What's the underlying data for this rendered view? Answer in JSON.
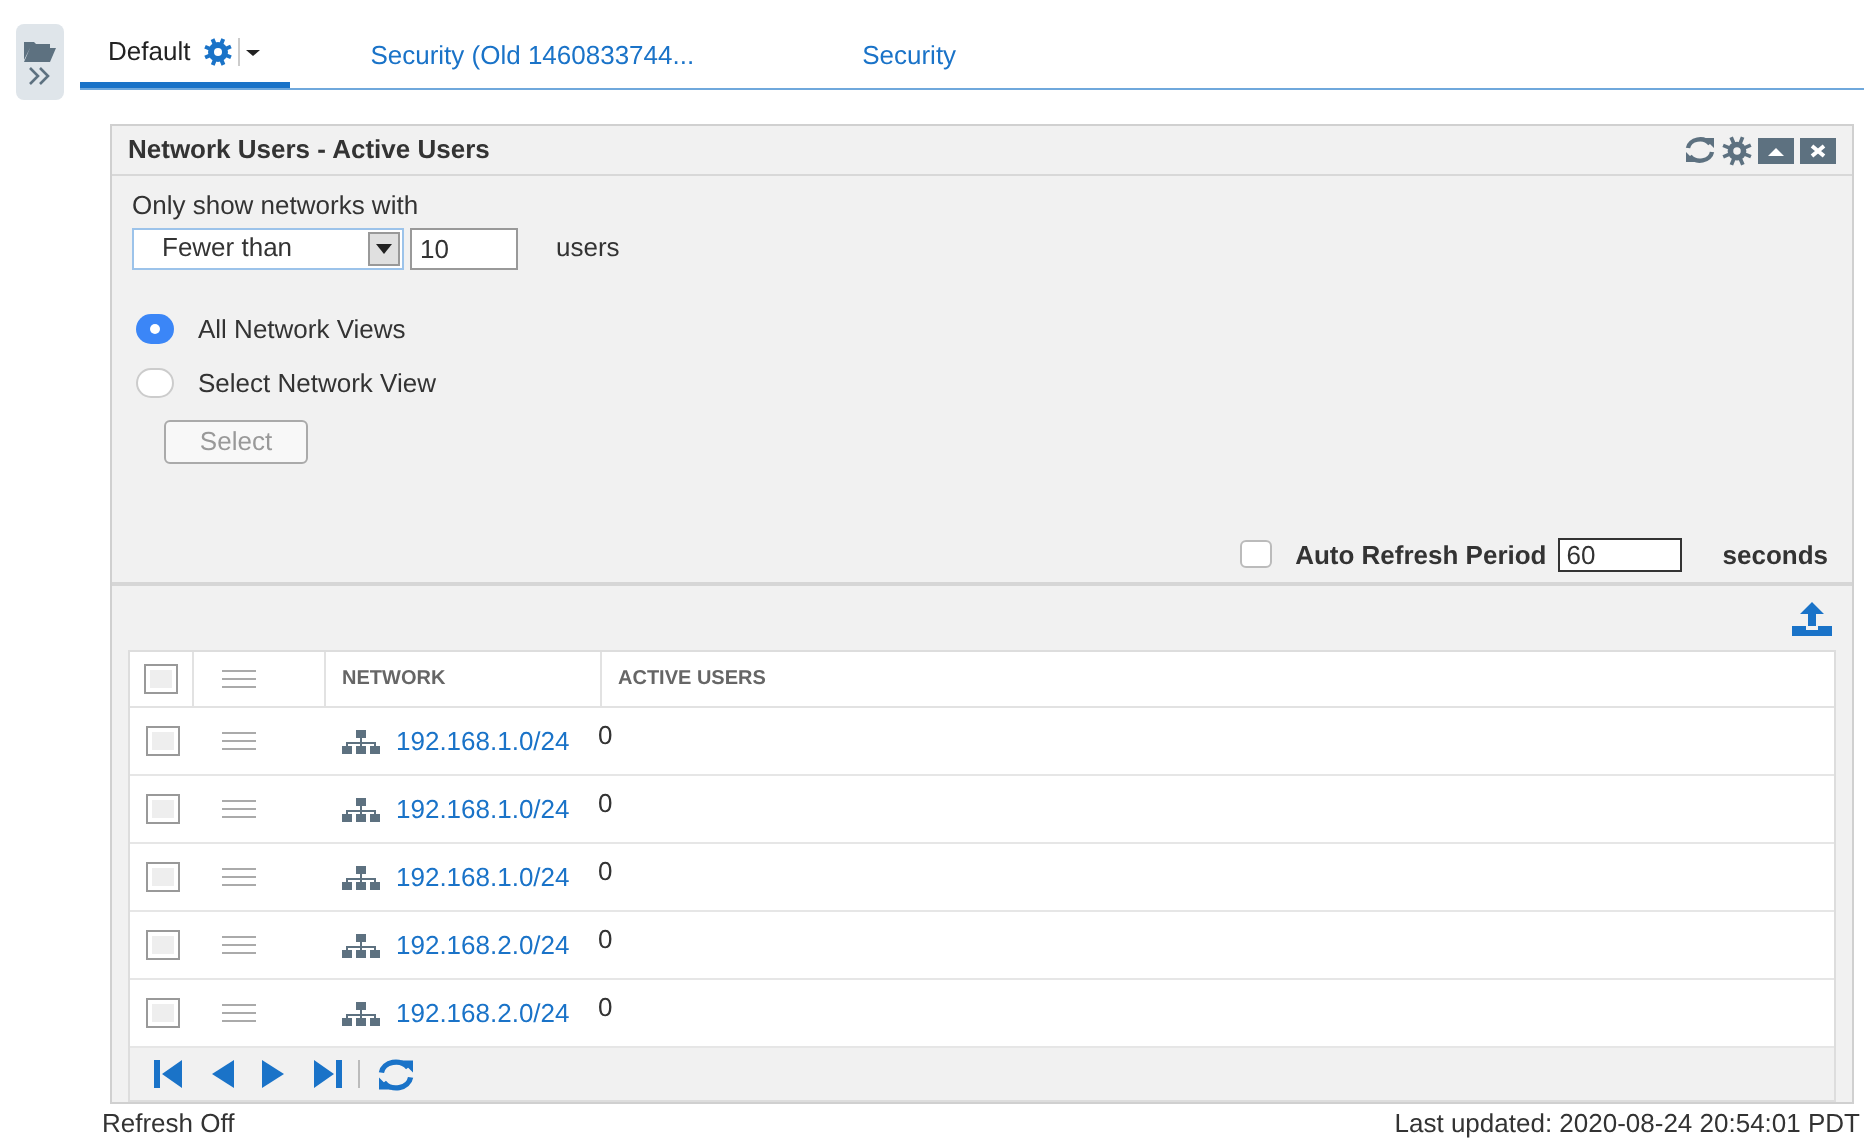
{
  "tabs": [
    {
      "label": "Default",
      "selected": true,
      "has_settings": true
    },
    {
      "label": "Security (Old 1460833744...",
      "selected": false,
      "has_settings": false
    },
    {
      "label": "Security",
      "selected": false,
      "has_settings": false
    }
  ],
  "panel": {
    "title": "Network Users - Active Users",
    "filter": {
      "label": "Only show networks with",
      "operator": "Fewer than",
      "count": "10",
      "unit": "users"
    },
    "views": [
      {
        "label": "All Network Views",
        "selected": true
      },
      {
        "label": "Select Network View",
        "selected": false
      }
    ],
    "select_button": {
      "label": "Select",
      "disabled": true
    },
    "auto_refresh": {
      "checked": false,
      "label": "Auto Refresh Period",
      "value": "60",
      "unit": "seconds"
    },
    "table": {
      "select_all_checked": false,
      "columns": [
        "NETWORK",
        "ACTIVE USERS"
      ],
      "rows": [
        {
          "checked": false,
          "network": "192.168.1.0/24",
          "active_users": "0"
        },
        {
          "checked": false,
          "network": "192.168.1.0/24",
          "active_users": "0"
        },
        {
          "checked": false,
          "network": "192.168.1.0/24",
          "active_users": "0"
        },
        {
          "checked": false,
          "network": "192.168.2.0/24",
          "active_users": "0"
        },
        {
          "checked": false,
          "network": "192.168.2.0/24",
          "active_users": "0"
        }
      ]
    }
  },
  "status_bar": {
    "refresh": "Refresh Off",
    "last_updated": "Last updated: 2020-08-24 20:54:01 PDT"
  }
}
